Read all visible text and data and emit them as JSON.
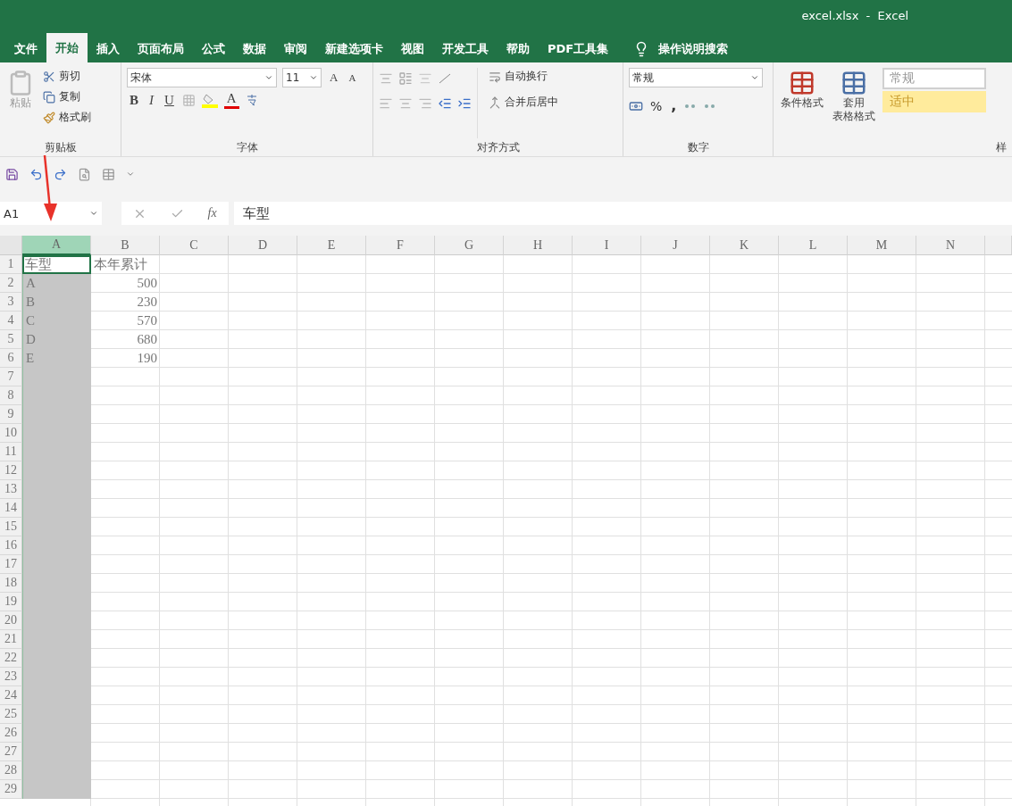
{
  "window": {
    "title": "excel.xlsx  -  Excel"
  },
  "tabs": [
    {
      "label": "文件",
      "selected": false
    },
    {
      "label": "开始",
      "selected": true
    },
    {
      "label": "插入",
      "selected": false
    },
    {
      "label": "页面布局",
      "selected": false
    },
    {
      "label": "公式",
      "selected": false
    },
    {
      "label": "数据",
      "selected": false
    },
    {
      "label": "审阅",
      "selected": false
    },
    {
      "label": "新建选项卡",
      "selected": false
    },
    {
      "label": "视图",
      "selected": false
    },
    {
      "label": "开发工具",
      "selected": false
    },
    {
      "label": "帮助",
      "selected": false
    },
    {
      "label": "PDF工具集",
      "selected": false
    }
  ],
  "search": {
    "placeholder": "操作说明搜索"
  },
  "ribbon": {
    "clipboard": {
      "label": "剪贴板",
      "paste": "粘贴",
      "cut": "剪切",
      "copy": "复制",
      "format_painter": "格式刷"
    },
    "font": {
      "label": "字体",
      "name": "宋体",
      "size": "11",
      "grow": "A",
      "shrink": "A",
      "bold": "B",
      "italic": "I",
      "underline": "U",
      "font_color": "A"
    },
    "alignment": {
      "label": "对齐方式",
      "wrap": "自动换行",
      "merge": "合并后居中"
    },
    "number": {
      "label": "数字",
      "format": "常规",
      "percent": "%",
      "comma": ","
    },
    "styles": {
      "label": "样",
      "conditional": "条件格式",
      "table_format_1": "套用",
      "table_format_2": "表格格式",
      "normal": "常规",
      "neutral": "适中"
    }
  },
  "formula_bar": {
    "name_box": "A1",
    "fx": "fx",
    "value": "车型"
  },
  "columns": [
    {
      "label": "A",
      "selected": true
    },
    {
      "label": "B",
      "selected": false
    },
    {
      "label": "C",
      "selected": false
    },
    {
      "label": "D",
      "selected": false
    },
    {
      "label": "E",
      "selected": false
    },
    {
      "label": "F",
      "selected": false
    },
    {
      "label": "G",
      "selected": false
    },
    {
      "label": "H",
      "selected": false
    },
    {
      "label": "I",
      "selected": false
    },
    {
      "label": "J",
      "selected": false
    },
    {
      "label": "K",
      "selected": false
    },
    {
      "label": "L",
      "selected": false
    },
    {
      "label": "M",
      "selected": false
    },
    {
      "label": "N",
      "selected": false
    }
  ],
  "row_numbers": [
    "1",
    "2",
    "3",
    "4",
    "5",
    "6",
    "7",
    "8",
    "9",
    "10",
    "11",
    "12",
    "13",
    "14",
    "15",
    "16",
    "17",
    "18",
    "19",
    "20",
    "21",
    "22",
    "23",
    "24",
    "25",
    "26",
    "27",
    "28",
    "29"
  ],
  "rows": [
    [
      {
        "kind": "text",
        "value": "车型"
      },
      {
        "kind": "text",
        "value": "本年累计"
      }
    ],
    [
      {
        "kind": "text",
        "value": "A"
      },
      {
        "kind": "number",
        "value": "500"
      }
    ],
    [
      {
        "kind": "text",
        "value": "B"
      },
      {
        "kind": "number",
        "value": "230"
      }
    ],
    [
      {
        "kind": "text",
        "value": "C"
      },
      {
        "kind": "number",
        "value": "570"
      }
    ],
    [
      {
        "kind": "text",
        "value": "D"
      },
      {
        "kind": "number",
        "value": "680"
      }
    ],
    [
      {
        "kind": "text",
        "value": "E"
      },
      {
        "kind": "number",
        "value": "190"
      }
    ]
  ]
}
